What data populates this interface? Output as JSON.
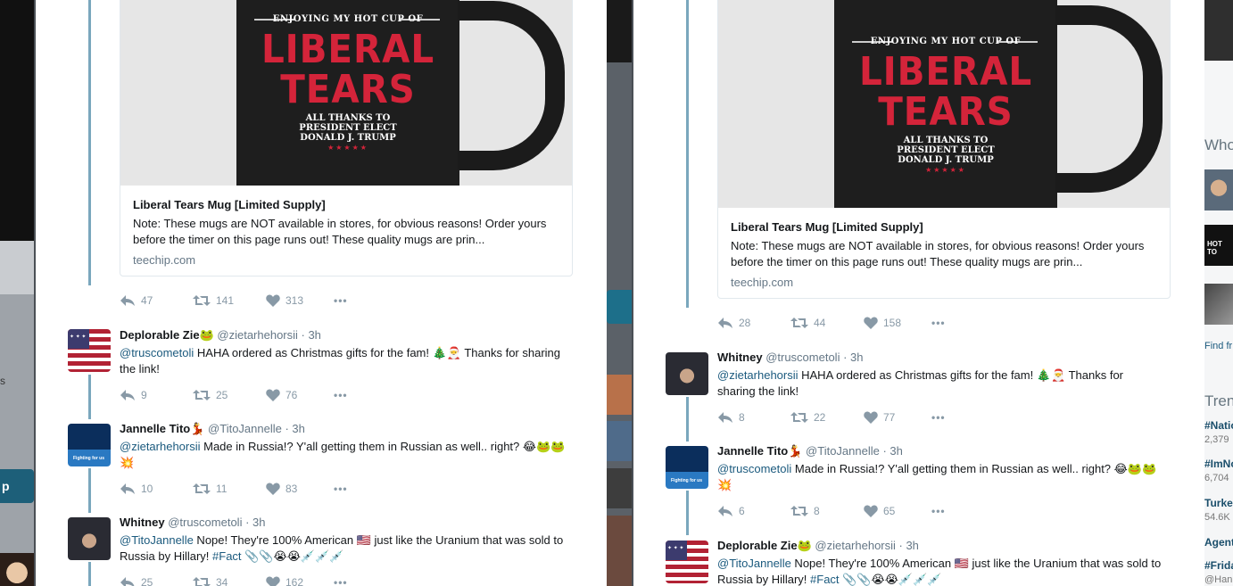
{
  "background": {
    "left_button_label": "p",
    "left_letter": "s"
  },
  "right_sidebar": {
    "who_to_follow": "Who",
    "hot_label": "HOT TO",
    "find_link": "Find fr",
    "trends_title": "Tren",
    "trends": [
      {
        "name": "#Natio",
        "count": "2,379"
      },
      {
        "name": "#ImNo",
        "count": "6,704"
      },
      {
        "name": "Turke",
        "count": "54.6K"
      },
      {
        "name": "Agent",
        "count": ""
      },
      {
        "name": "#Frida",
        "count": "@Han"
      }
    ]
  },
  "columns": [
    {
      "card": {
        "mug_top_text": "ENJOYING MY HOT CUP OF",
        "mug_line1": "LIBERAL",
        "mug_line2": "TEARS",
        "mug_bottom_text": [
          "ALL THANKS TO",
          "PRESIDENT ELECT",
          "DONALD J. TRUMP"
        ],
        "mug_stars": "★★★★★",
        "title": "Liberal Tears Mug [Limited Supply]",
        "description": "Note: These mugs are NOT available in stores, for obvious reasons! Order yours before the timer on this page runs out! These quality mugs are prin...",
        "domain": "teechip.com"
      },
      "card_actions": {
        "replies": "47",
        "retweets": "141",
        "likes": "313"
      },
      "tweets": [
        {
          "avatar": "flag",
          "name": "Deplorable Zie🐸",
          "handle": "@zietarhehorsii · 3h",
          "mention": "@truscometoli",
          "text": " HAHA ordered as Christmas gifts for the fam! 🎄🎅 Thanks for sharing the link!",
          "replies": "9",
          "retweets": "25",
          "likes": "76"
        },
        {
          "avatar": "campaign",
          "name": "Jannelle Tito💃",
          "handle": "@TitoJannelle · 3h",
          "mention": "@zietarhehorsii",
          "text": " Made in Russia!? Y'all getting them in Russian as well.. right? 😂🐸🐸💥",
          "replies": "10",
          "retweets": "11",
          "likes": "83"
        },
        {
          "avatar": "photo",
          "name": "Whitney",
          "handle": "@truscometoli · 3h",
          "mention": "@TitoJannelle",
          "text": " Nope! They're 100% American 🇺🇸 just like the Uranium that was sold to Russia by Hillary! ",
          "hashtag": "#Fact",
          "tail": " 📎📎😭😭💉💉💉",
          "replies": "25",
          "retweets": "34",
          "likes": "162"
        }
      ]
    },
    {
      "card": {
        "mug_top_text": "ENJOYING MY HOT CUP OF",
        "mug_line1": "LIBERAL",
        "mug_line2": "TEARS",
        "mug_bottom_text": [
          "ALL THANKS TO",
          "PRESIDENT ELECT",
          "DONALD J. TRUMP"
        ],
        "mug_stars": "★★★★★",
        "title": "Liberal Tears Mug [Limited Supply]",
        "description": "Note: These mugs are NOT available in stores, for obvious reasons! Order yours before the timer on this page runs out! These quality mugs are prin...",
        "domain": "teechip.com"
      },
      "card_actions": {
        "replies": "28",
        "retweets": "44",
        "likes": "158"
      },
      "tweets": [
        {
          "avatar": "photo",
          "name": "Whitney",
          "handle": "@truscometoli · 3h",
          "mention": "@zietarhehorsii",
          "text": " HAHA ordered as Christmas gifts for the fam! 🎄🎅 Thanks for sharing the link!",
          "replies": "8",
          "retweets": "22",
          "likes": "77"
        },
        {
          "avatar": "campaign",
          "name": "Jannelle Tito💃",
          "handle": "@TitoJannelle · 3h",
          "mention": "@truscometoli",
          "text": " Made in Russia!? Y'all getting them in Russian as well.. right? 😂🐸🐸💥",
          "replies": "6",
          "retweets": "8",
          "likes": "65"
        },
        {
          "avatar": "flag",
          "name": "Deplorable Zie🐸",
          "handle": "@zietarhehorsii · 3h",
          "mention": "@TitoJannelle",
          "text": " Nope! They're 100% American 🇺🇸 just like the Uranium that was sold to Russia by Hillary! ",
          "hashtag": "#Fact",
          "tail": " 📎📎😭😭💉💉💉",
          "replies": "",
          "retweets": "",
          "likes": ""
        }
      ]
    }
  ]
}
